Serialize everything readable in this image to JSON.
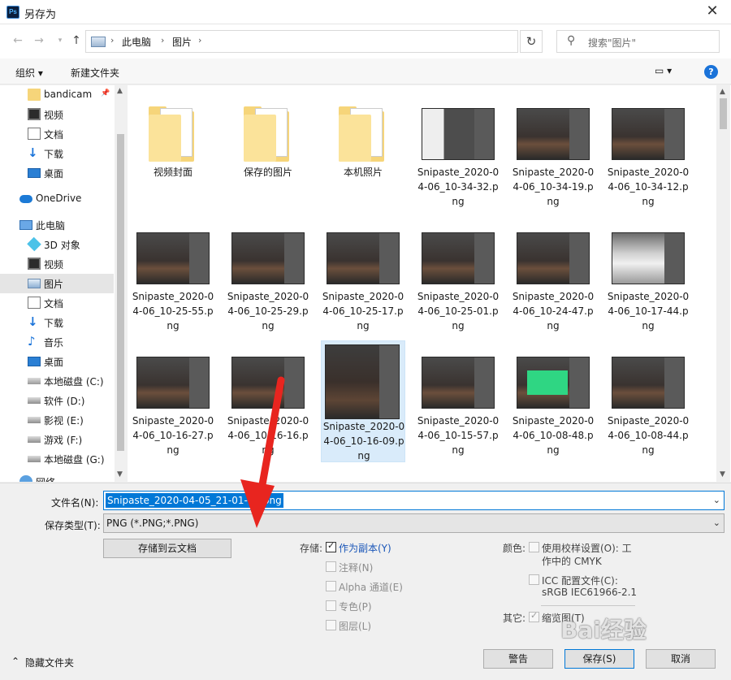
{
  "window": {
    "title": "另存为",
    "app_icon": "Ps"
  },
  "nav": {
    "breadcrumbs": [
      "此电脑",
      "图片"
    ],
    "search_placeholder": "搜索\"图片\""
  },
  "toolbar": {
    "organize": "组织 ▾",
    "new_folder": "新建文件夹"
  },
  "sidebar": {
    "items": [
      {
        "label": "bandicam",
        "icon": "folder-icon"
      },
      {
        "label": "视频",
        "icon": "video-icon"
      },
      {
        "label": "文档",
        "icon": "document-icon"
      },
      {
        "label": "下载",
        "icon": "download-icon"
      },
      {
        "label": "桌面",
        "icon": "desktop-icon"
      },
      {
        "label": "OneDrive",
        "icon": "cloud-icon"
      },
      {
        "label": "此电脑",
        "icon": "computer-icon"
      },
      {
        "label": "3D 对象",
        "icon": "cube-icon"
      },
      {
        "label": "视频",
        "icon": "video-icon"
      },
      {
        "label": "图片",
        "icon": "picture-icon"
      },
      {
        "label": "文档",
        "icon": "document-icon"
      },
      {
        "label": "下载",
        "icon": "download-icon"
      },
      {
        "label": "音乐",
        "icon": "music-icon"
      },
      {
        "label": "桌面",
        "icon": "desktop-icon"
      },
      {
        "label": "本地磁盘 (C:)",
        "icon": "windows-drive-icon"
      },
      {
        "label": "软件 (D:)",
        "icon": "drive-icon"
      },
      {
        "label": "影视 (E:)",
        "icon": "drive-icon"
      },
      {
        "label": "游戏 (F:)",
        "icon": "drive-icon"
      },
      {
        "label": "本地磁盘 (G:)",
        "icon": "drive-icon"
      },
      {
        "label": "网络",
        "icon": "network-icon"
      }
    ],
    "selected": "图片"
  },
  "files": [
    {
      "name": "视频封面",
      "kind": "folder"
    },
    {
      "name": "保存的图片",
      "kind": "folder"
    },
    {
      "name": "本机照片",
      "kind": "folder"
    },
    {
      "name": "Snipaste_2020-04-06_10-34-32.png",
      "kind": "menu"
    },
    {
      "name": "Snipaste_2020-04-06_10-34-19.png",
      "kind": "image"
    },
    {
      "name": "Snipaste_2020-04-06_10-34-12.png",
      "kind": "image"
    },
    {
      "name": "Snipaste_2020-04-06_10-25-55.png",
      "kind": "image"
    },
    {
      "name": "Snipaste_2020-04-06_10-25-29.png",
      "kind": "image"
    },
    {
      "name": "Snipaste_2020-04-06_10-25-17.png",
      "kind": "image"
    },
    {
      "name": "Snipaste_2020-04-06_10-25-01.png",
      "kind": "image"
    },
    {
      "name": "Snipaste_2020-04-06_10-24-47.png",
      "kind": "image"
    },
    {
      "name": "Snipaste_2020-04-06_10-17-44.png",
      "kind": "fog"
    },
    {
      "name": "Snipaste_2020-04-06_10-16-27.png",
      "kind": "image"
    },
    {
      "name": "Snipaste_2020-04-06_10-16-16.png",
      "kind": "image"
    },
    {
      "name": "Snipaste_2020-04-06_10-16-09.png",
      "kind": "tall",
      "selected": true
    },
    {
      "name": "Snipaste_2020-04-06_10-15-57.png",
      "kind": "image"
    },
    {
      "name": "Snipaste_2020-04-06_10-08-48.png",
      "kind": "green"
    },
    {
      "name": "Snipaste_2020-04-06_10-08-44.png",
      "kind": "image"
    }
  ],
  "form": {
    "filename_label": "文件名(N):",
    "filename_value": "Snipaste_2020-04-05_21-01-10.png",
    "filetype_label": "保存类型(T):",
    "filetype_value": "PNG (*.PNG;*.PNG)",
    "cloud_button": "存储到云文档"
  },
  "options": {
    "storage_label": "存储:",
    "storage": [
      {
        "label": "作为副本(Y)",
        "checked": true,
        "enabled": true
      },
      {
        "label": "注释(N)",
        "checked": false,
        "enabled": false
      },
      {
        "label": "Alpha 通道(E)",
        "checked": false,
        "enabled": false
      },
      {
        "label": "专色(P)",
        "checked": false,
        "enabled": false
      },
      {
        "label": "图层(L)",
        "checked": false,
        "enabled": false
      }
    ],
    "color_label": "颜色:",
    "proof_setup": "使用校样设置(O): 工",
    "proof_setup_sub": "作中的 CMYK",
    "icc_label": "ICC 配置文件(C):",
    "icc_sub": "sRGB IEC61966-2.1",
    "other_label": "其它:",
    "thumbnail": "缩览图(T)"
  },
  "footer": {
    "hide_folders": "隐藏文件夹",
    "warning_button": "警告",
    "save_button": "保存(S)",
    "cancel_button": "取消"
  },
  "watermark": "Bai经验"
}
